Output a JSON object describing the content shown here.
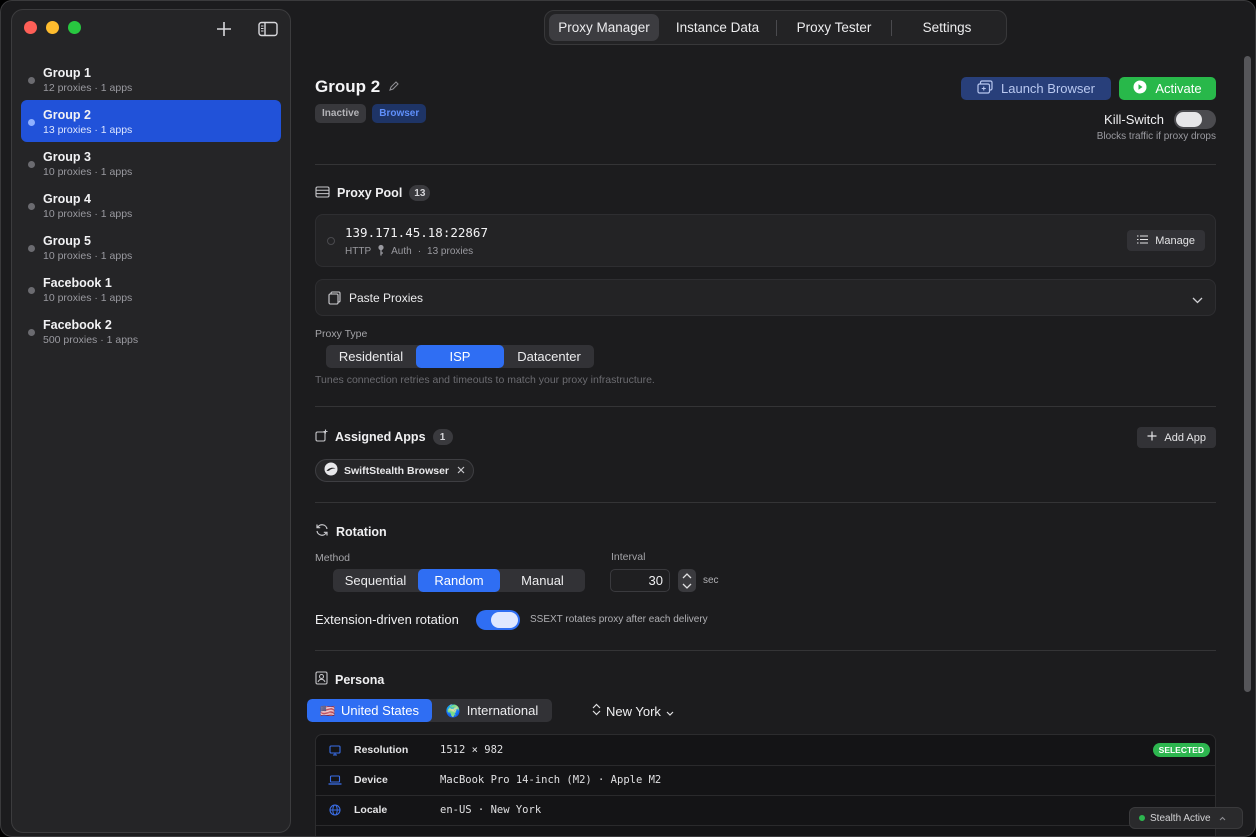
{
  "sidebar": {
    "groups": [
      {
        "name": "Group 1",
        "sub": "12 proxies · 1 apps"
      },
      {
        "name": "Group 2",
        "sub": "13 proxies · 1 apps"
      },
      {
        "name": "Group 3",
        "sub": "10 proxies · 1 apps"
      },
      {
        "name": "Group 4",
        "sub": "10 proxies · 1 apps"
      },
      {
        "name": "Group 5",
        "sub": "10 proxies · 1 apps"
      },
      {
        "name": "Facebook 1",
        "sub": "10 proxies · 1 apps"
      },
      {
        "name": "Facebook 2",
        "sub": "500 proxies · 1 apps"
      }
    ],
    "add_icon": "plus-icon",
    "toggle_icon": "sidebar-icon"
  },
  "tabs": [
    "Proxy Manager",
    "Instance Data",
    "Proxy Tester",
    "Settings"
  ],
  "header": {
    "title": "Group 2",
    "badge_status": "Inactive",
    "badge_type": "Browser",
    "launch_label": "Launch Browser",
    "activate_label": "Activate",
    "kill_switch_label": "Kill-Switch",
    "kill_switch_hint": "Blocks traffic if proxy drops",
    "kill_switch_on": false
  },
  "proxy_pool": {
    "title": "Proxy Pool",
    "count": "13",
    "address": "139.171.45.18:22867",
    "protocol": "HTTP",
    "auth": "Auth",
    "sep": "·",
    "proxies": "13 proxies",
    "manage_label": "Manage"
  },
  "paste": {
    "label": "Paste Proxies"
  },
  "proxy_type": {
    "label": "Proxy Type",
    "options": [
      "Residential",
      "ISP",
      "Datacenter"
    ],
    "selected": "ISP",
    "hint": "Tunes connection retries and timeouts to match your proxy infrastructure."
  },
  "assigned_apps": {
    "title": "Assigned Apps",
    "count": "1",
    "add_label": "Add App",
    "apps": [
      "SwiftStealth Browser"
    ]
  },
  "rotation": {
    "title": "Rotation",
    "method_label": "Method",
    "methods": [
      "Sequential",
      "Random",
      "Manual"
    ],
    "selected": "Random",
    "interval_label": "Interval",
    "interval_value": "30",
    "interval_unit": "sec",
    "ext_label": "Extension-driven rotation",
    "ext_hint": "SSEXT rotates proxy after each delivery",
    "ext_on": true
  },
  "persona": {
    "title": "Persona",
    "regions": [
      "United States",
      "International"
    ],
    "region_flags": [
      "🇺🇸",
      "🌍"
    ],
    "selected_region": "United States",
    "city": "New York",
    "rows": [
      {
        "key": "Resolution",
        "value": "1512 × 982",
        "icon": "monitor-icon"
      },
      {
        "key": "Device",
        "value": "MacBook Pro 14-inch (M2) · Apple M2",
        "icon": "laptop-icon"
      },
      {
        "key": "Locale",
        "value": "en-US · New York",
        "icon": "globe-icon"
      }
    ],
    "selected_badge": "SELECTED"
  },
  "status": {
    "label": "Stealth Active",
    "color": "#2db64f"
  },
  "colors": {
    "accent": "#2f6ef3",
    "activate": "#28b84a",
    "selected_group": "#2152d9"
  }
}
